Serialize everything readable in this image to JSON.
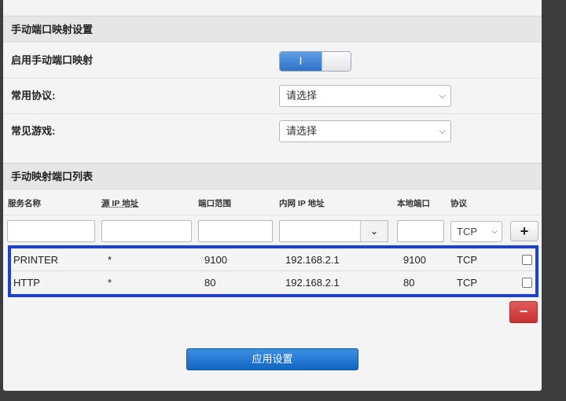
{
  "manual_mapping": {
    "section_title": "手动端口映射设置",
    "enable_label": "启用手动端口映射",
    "toggle_state": "I",
    "protocol_label": "常用协议:",
    "protocol_select": "请选择",
    "games_label": "常见游戏:",
    "games_select": "请选择"
  },
  "port_list": {
    "section_title": "手动映射端口列表",
    "columns": [
      "服务名称",
      "源 IP 地址",
      "端口范围",
      "内网 IP 地址",
      "本地端口",
      "协议"
    ],
    "new_entry_protocol": "TCP",
    "rows": [
      {
        "name": "PRINTER",
        "src_ip": "*",
        "port_range": "9100",
        "lan_ip": "192.168.2.1",
        "local_port": "9100",
        "protocol": "TCP"
      },
      {
        "name": "HTTP",
        "src_ip": "*",
        "port_range": "80",
        "lan_ip": "192.168.2.1",
        "local_port": "80",
        "protocol": "TCP"
      }
    ]
  },
  "buttons": {
    "add": "+",
    "delete": "−",
    "apply": "应用设置"
  },
  "icons": {
    "chevron": "chevron-down-icon",
    "add": "plus-icon",
    "delete": "minus-icon"
  }
}
